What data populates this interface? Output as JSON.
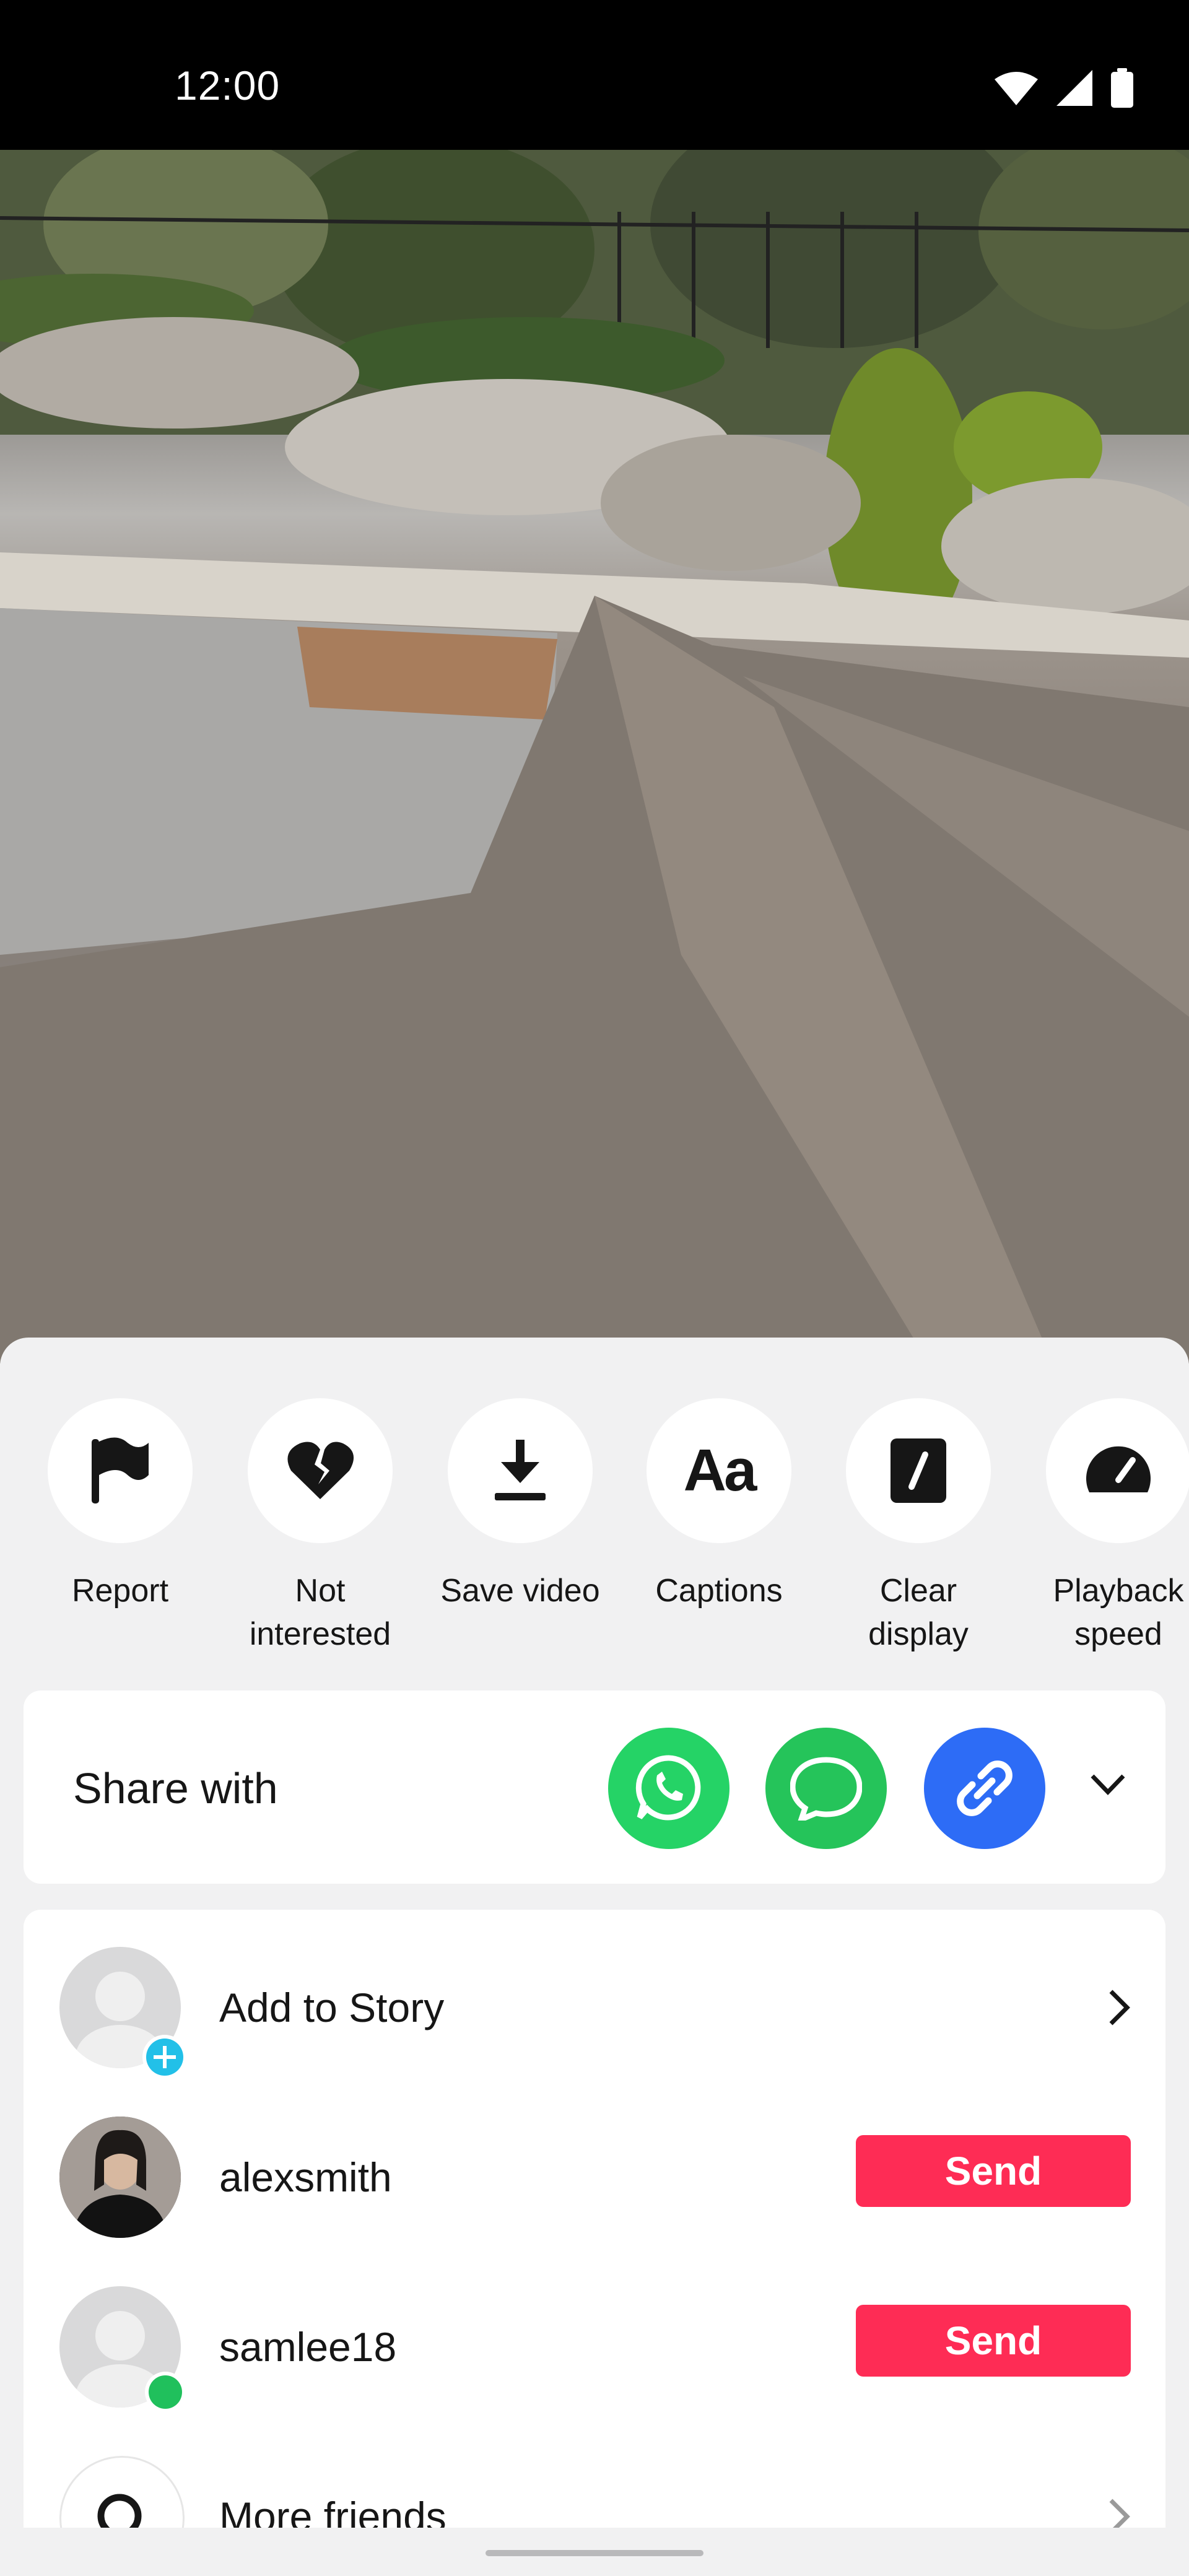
{
  "status_bar": {
    "time": "12:00"
  },
  "actions": [
    {
      "label": "Report",
      "icon": "flag-icon"
    },
    {
      "label": "Not interested",
      "icon": "broken-heart-icon"
    },
    {
      "label": "Save video",
      "icon": "download-icon"
    },
    {
      "label": "Captions",
      "icon": "captions-icon",
      "glyph": "Aa"
    },
    {
      "label": "Clear display",
      "icon": "clear-display-icon"
    },
    {
      "label": "Playback speed",
      "icon": "speedometer-icon"
    }
  ],
  "share": {
    "title": "Share with",
    "apps": [
      {
        "name": "whatsapp-icon",
        "color": "#25d366"
      },
      {
        "name": "message-icon",
        "color": "#25c45a"
      },
      {
        "name": "link-icon",
        "color": "#2d6cf6"
      }
    ]
  },
  "friends": {
    "add_to_story": "Add to Story",
    "items": [
      {
        "name": "alexsmith",
        "button": "Send"
      },
      {
        "name": "samlee18",
        "button": "Send"
      }
    ],
    "more_friends": "More friends"
  },
  "colors": {
    "send": "#fe2c55",
    "online": "#20c05c",
    "add_badge": "#22c0e8"
  }
}
